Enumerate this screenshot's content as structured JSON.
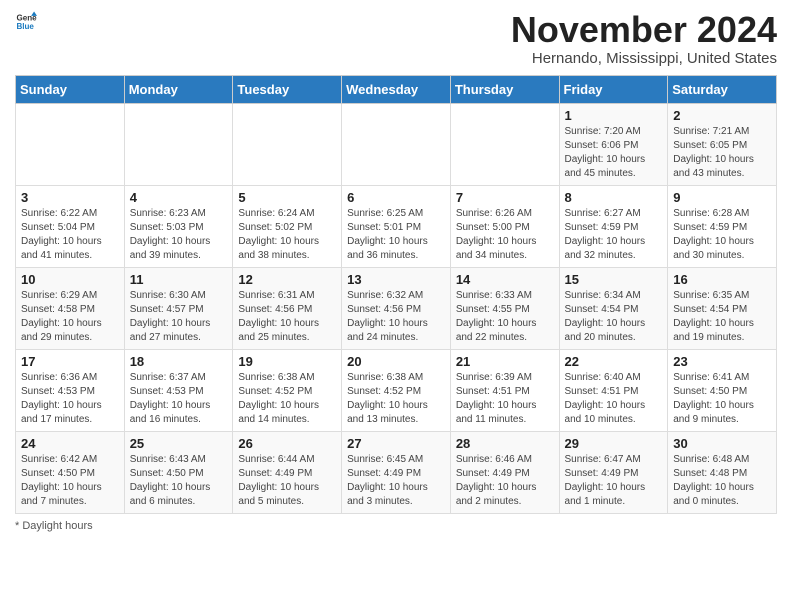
{
  "header": {
    "logo_line1": "General",
    "logo_line2": "Blue",
    "main_title": "November 2024",
    "subtitle": "Hernando, Mississippi, United States"
  },
  "days_of_week": [
    "Sunday",
    "Monday",
    "Tuesday",
    "Wednesday",
    "Thursday",
    "Friday",
    "Saturday"
  ],
  "weeks": [
    [
      {
        "day": "",
        "info": ""
      },
      {
        "day": "",
        "info": ""
      },
      {
        "day": "",
        "info": ""
      },
      {
        "day": "",
        "info": ""
      },
      {
        "day": "",
        "info": ""
      },
      {
        "day": "1",
        "info": "Sunrise: 7:20 AM\nSunset: 6:06 PM\nDaylight: 10 hours and 45 minutes."
      },
      {
        "day": "2",
        "info": "Sunrise: 7:21 AM\nSunset: 6:05 PM\nDaylight: 10 hours and 43 minutes."
      }
    ],
    [
      {
        "day": "3",
        "info": "Sunrise: 6:22 AM\nSunset: 5:04 PM\nDaylight: 10 hours and 41 minutes."
      },
      {
        "day": "4",
        "info": "Sunrise: 6:23 AM\nSunset: 5:03 PM\nDaylight: 10 hours and 39 minutes."
      },
      {
        "day": "5",
        "info": "Sunrise: 6:24 AM\nSunset: 5:02 PM\nDaylight: 10 hours and 38 minutes."
      },
      {
        "day": "6",
        "info": "Sunrise: 6:25 AM\nSunset: 5:01 PM\nDaylight: 10 hours and 36 minutes."
      },
      {
        "day": "7",
        "info": "Sunrise: 6:26 AM\nSunset: 5:00 PM\nDaylight: 10 hours and 34 minutes."
      },
      {
        "day": "8",
        "info": "Sunrise: 6:27 AM\nSunset: 4:59 PM\nDaylight: 10 hours and 32 minutes."
      },
      {
        "day": "9",
        "info": "Sunrise: 6:28 AM\nSunset: 4:59 PM\nDaylight: 10 hours and 30 minutes."
      }
    ],
    [
      {
        "day": "10",
        "info": "Sunrise: 6:29 AM\nSunset: 4:58 PM\nDaylight: 10 hours and 29 minutes."
      },
      {
        "day": "11",
        "info": "Sunrise: 6:30 AM\nSunset: 4:57 PM\nDaylight: 10 hours and 27 minutes."
      },
      {
        "day": "12",
        "info": "Sunrise: 6:31 AM\nSunset: 4:56 PM\nDaylight: 10 hours and 25 minutes."
      },
      {
        "day": "13",
        "info": "Sunrise: 6:32 AM\nSunset: 4:56 PM\nDaylight: 10 hours and 24 minutes."
      },
      {
        "day": "14",
        "info": "Sunrise: 6:33 AM\nSunset: 4:55 PM\nDaylight: 10 hours and 22 minutes."
      },
      {
        "day": "15",
        "info": "Sunrise: 6:34 AM\nSunset: 4:54 PM\nDaylight: 10 hours and 20 minutes."
      },
      {
        "day": "16",
        "info": "Sunrise: 6:35 AM\nSunset: 4:54 PM\nDaylight: 10 hours and 19 minutes."
      }
    ],
    [
      {
        "day": "17",
        "info": "Sunrise: 6:36 AM\nSunset: 4:53 PM\nDaylight: 10 hours and 17 minutes."
      },
      {
        "day": "18",
        "info": "Sunrise: 6:37 AM\nSunset: 4:53 PM\nDaylight: 10 hours and 16 minutes."
      },
      {
        "day": "19",
        "info": "Sunrise: 6:38 AM\nSunset: 4:52 PM\nDaylight: 10 hours and 14 minutes."
      },
      {
        "day": "20",
        "info": "Sunrise: 6:38 AM\nSunset: 4:52 PM\nDaylight: 10 hours and 13 minutes."
      },
      {
        "day": "21",
        "info": "Sunrise: 6:39 AM\nSunset: 4:51 PM\nDaylight: 10 hours and 11 minutes."
      },
      {
        "day": "22",
        "info": "Sunrise: 6:40 AM\nSunset: 4:51 PM\nDaylight: 10 hours and 10 minutes."
      },
      {
        "day": "23",
        "info": "Sunrise: 6:41 AM\nSunset: 4:50 PM\nDaylight: 10 hours and 9 minutes."
      }
    ],
    [
      {
        "day": "24",
        "info": "Sunrise: 6:42 AM\nSunset: 4:50 PM\nDaylight: 10 hours and 7 minutes."
      },
      {
        "day": "25",
        "info": "Sunrise: 6:43 AM\nSunset: 4:50 PM\nDaylight: 10 hours and 6 minutes."
      },
      {
        "day": "26",
        "info": "Sunrise: 6:44 AM\nSunset: 4:49 PM\nDaylight: 10 hours and 5 minutes."
      },
      {
        "day": "27",
        "info": "Sunrise: 6:45 AM\nSunset: 4:49 PM\nDaylight: 10 hours and 3 minutes."
      },
      {
        "day": "28",
        "info": "Sunrise: 6:46 AM\nSunset: 4:49 PM\nDaylight: 10 hours and 2 minutes."
      },
      {
        "day": "29",
        "info": "Sunrise: 6:47 AM\nSunset: 4:49 PM\nDaylight: 10 hours and 1 minute."
      },
      {
        "day": "30",
        "info": "Sunrise: 6:48 AM\nSunset: 4:48 PM\nDaylight: 10 hours and 0 minutes."
      }
    ]
  ],
  "footer": {
    "note": "Daylight hours"
  }
}
